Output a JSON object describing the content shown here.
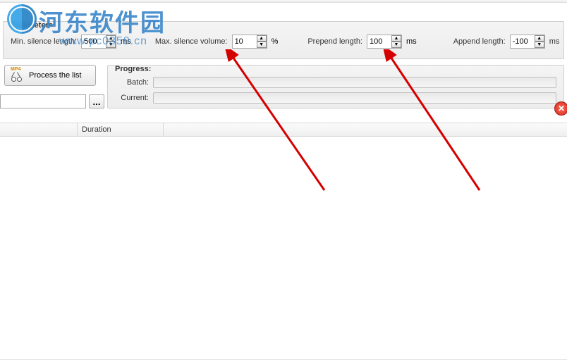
{
  "watermark": {
    "text": "河东软件园",
    "sub": "www.pc0359.cn"
  },
  "parameters": {
    "title": "Parameters:",
    "min_silence_label": "Min. silence length:",
    "min_silence_value": "500",
    "min_silence_unit": "ms",
    "max_silence_label": "Max. silence volume:",
    "max_silence_value": "10",
    "max_silence_unit": "%",
    "prepend_label": "Prepend length:",
    "prepend_value": "100",
    "prepend_unit": "ms",
    "append_label": "Append length:",
    "append_value": "-100",
    "append_unit": "ms"
  },
  "actions": {
    "process_label": "Process the list",
    "browse_label": "..."
  },
  "path": {
    "value": ""
  },
  "progress": {
    "title": "Progress:",
    "batch_label": "Batch:",
    "current_label": "Current:"
  },
  "table": {
    "col1": "",
    "col2": "Duration"
  },
  "close_icon": "✕"
}
